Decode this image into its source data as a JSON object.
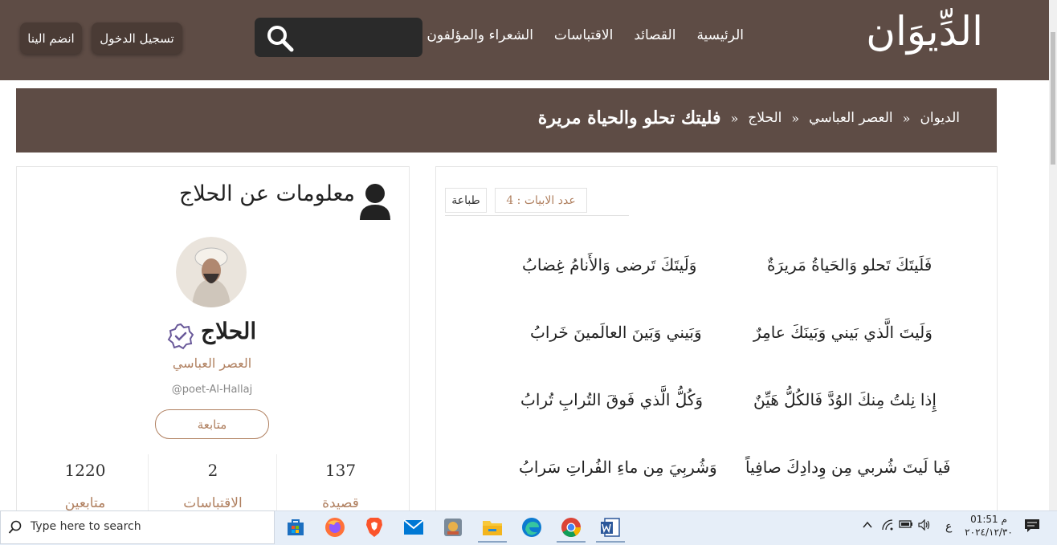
{
  "header": {
    "logo_text": "الدِّيوَان",
    "nav": [
      "الرئيسية",
      "القصائد",
      "الاقتباسات",
      "الشعراء والمؤلفون"
    ],
    "login_label": "تسجيل الدخول",
    "join_label": "انضم الينا"
  },
  "breadcrumb": {
    "items": [
      "الديوان",
      "العصر العباسي",
      "الحلاج"
    ],
    "separator": "»",
    "current": "فليتك تحلو والحياة مريرة"
  },
  "poem": {
    "verse_count_label": "عدد الابيات : 4",
    "print_label": "طباعة",
    "verses": [
      {
        "right": "فَلَيتَكَ تَحلو وَالحَياةُ مَريرَةٌ",
        "left": "وَلَيتَكَ تَرضى وَالأَنامُ غِضابُ"
      },
      {
        "right": "وَلَيتَ الَّذي بَيني وَبَينَكَ عامِرٌ",
        "left": "وَبَيني وَبَينَ العالَمينَ خَرابُ"
      },
      {
        "right": "إِذا نِلتُ مِنكَ الوُدَّ فَالكُلُّ هَيِّنٌ",
        "left": "وَكُلُّ الَّذي فَوقَ التُرابِ تُرابُ"
      },
      {
        "right": "فَيا لَيتَ شُربي مِن وِدادِكَ صافِياً",
        "left": "وَشُربِيَ مِن ماءِ الفُراتِ سَرابُ"
      }
    ]
  },
  "poet": {
    "section_title": "معلومات عن الحلاج",
    "name": "الحلاج",
    "era": "العصر العباسي",
    "handle": "@poet-Al-Hallaj",
    "follow_label": "متابعة",
    "stats": [
      {
        "value": "137",
        "label": "قصيدة"
      },
      {
        "value": "2",
        "label": "الاقتباسات"
      },
      {
        "value": "1220",
        "label": "متابعين"
      }
    ]
  },
  "taskbar": {
    "search_placeholder": "Type here to search",
    "lang": "ع",
    "time": "01:51 م",
    "date": "٢٠٢٤/١٢/٣٠",
    "apps": [
      "store-icon",
      "firefox-icon",
      "brave-icon",
      "mail-icon",
      "app-icon",
      "file-explorer-icon",
      "edge-icon",
      "chrome-icon",
      "word-icon"
    ]
  },
  "colors": {
    "header_bg": "#5e4c45",
    "accent": "#b08060"
  }
}
